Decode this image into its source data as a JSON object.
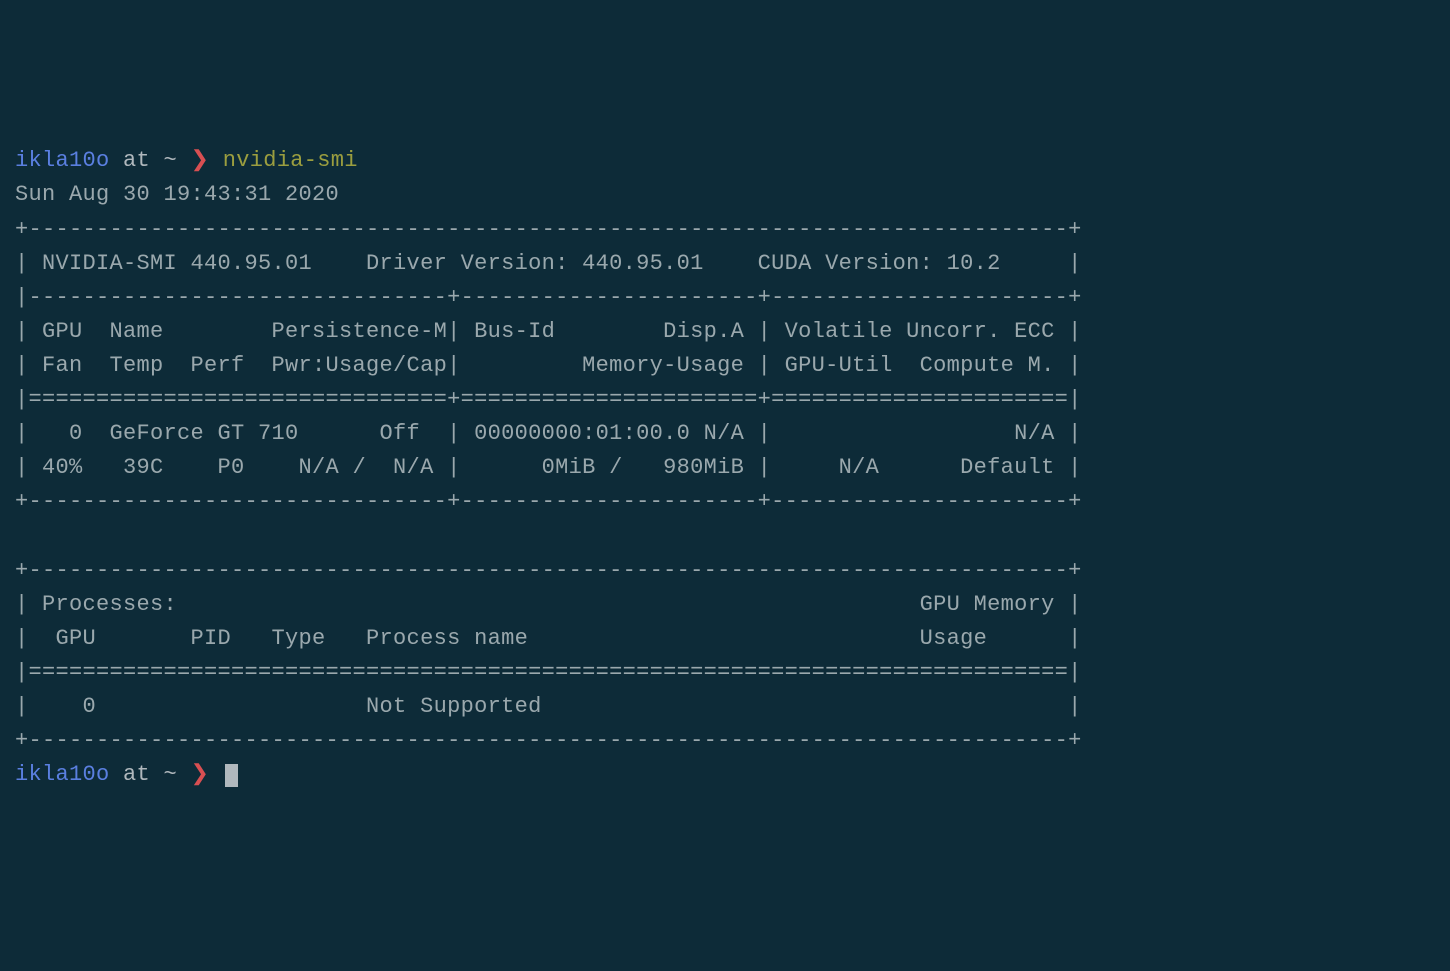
{
  "prompt1": {
    "user": "ikla10o",
    "at_path": " at ~ ",
    "prompt_char": "❯",
    "command": " nvidia-smi"
  },
  "output": {
    "timestamp": "Sun Aug 30 19:43:31 2020",
    "l1": "+-----------------------------------------------------------------------------+",
    "l2": "| NVIDIA-SMI 440.95.01    Driver Version: 440.95.01    CUDA Version: 10.2     |",
    "l3": "|-------------------------------+----------------------+----------------------+",
    "l4": "| GPU  Name        Persistence-M| Bus-Id        Disp.A | Volatile Uncorr. ECC |",
    "l5": "| Fan  Temp  Perf  Pwr:Usage/Cap|         Memory-Usage | GPU-Util  Compute M. |",
    "l6": "|===============================+======================+======================|",
    "l7": "|   0  GeForce GT 710      Off  | 00000000:01:00.0 N/A |                  N/A |",
    "l8": "| 40%   39C    P0    N/A /  N/A |      0MiB /   980MiB |     N/A      Default |",
    "l9": "+-------------------------------+----------------------+----------------------+",
    "l10": "                                                                               ",
    "l11": "+-----------------------------------------------------------------------------+",
    "l12": "| Processes:                                                       GPU Memory |",
    "l13": "|  GPU       PID   Type   Process name                             Usage      |",
    "l14": "|=============================================================================|",
    "l15": "|    0                    Not Supported                                       |",
    "l16": "+-----------------------------------------------------------------------------+"
  },
  "prompt2": {
    "user": "ikla10o",
    "at_path": " at ~ ",
    "prompt_char": "❯"
  }
}
